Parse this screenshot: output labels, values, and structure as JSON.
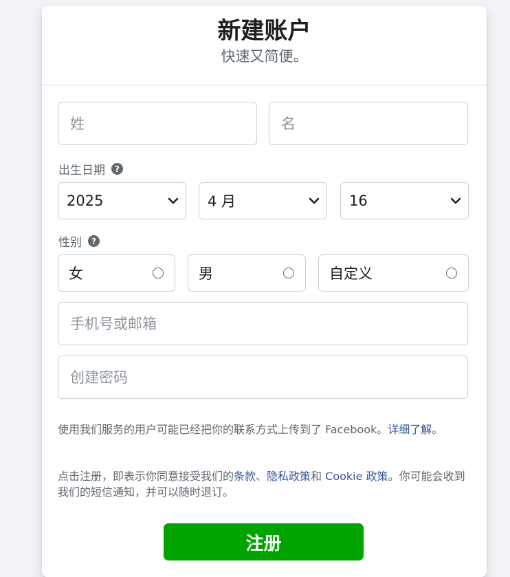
{
  "header": {
    "title": "新建账户",
    "subtitle": "快速又简便。"
  },
  "name": {
    "last_placeholder": "姓",
    "first_placeholder": "名"
  },
  "birthday": {
    "label": "出生日期",
    "year": "2025",
    "month": "4 月",
    "day": "16"
  },
  "gender": {
    "label": "性别",
    "options": [
      "女",
      "男",
      "自定义"
    ]
  },
  "contact": {
    "placeholder": "手机号或邮箱"
  },
  "password": {
    "placeholder": "创建密码"
  },
  "legal": {
    "contacts_text": "使用我们服务的用户可能已经把你的联系方式上传到了 Facebook。",
    "learn_more": "详细了解",
    "contacts_end": "。",
    "terms_prefix": "点击注册，即表示你同意接受我们的",
    "terms_link": "条款",
    "sep1": "、",
    "privacy_link": "隐私政策",
    "and": "和 ",
    "cookie_link": "Cookie 政策",
    "terms_suffix": "。你可能会收到我们的短信通知，并可以随时退订。"
  },
  "signup_label": "注册",
  "colors": {
    "primary_green": "#00a400",
    "link_blue": "#385898",
    "secondary_text": "#606770",
    "background": "#f0f2f5"
  },
  "icons": {
    "help": "help-circle-icon",
    "select": "chevron-down-icon",
    "radio": "radio-empty-icon"
  }
}
